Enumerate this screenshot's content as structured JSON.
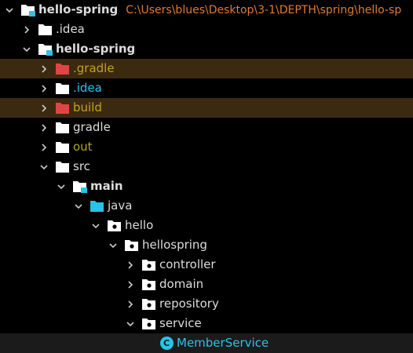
{
  "colors": {
    "background": "#000000",
    "text": "#dcdcdc",
    "excluded_text": "#c4a024",
    "output_text": "#b2a52a",
    "source_text": "#28c4e6",
    "path_text": "#e07b32",
    "excluded_row_bg": "#3c2a10",
    "selected_row_bg": "#1b1b1b",
    "folder_plain": "#ffffff",
    "folder_excluded": "#e04545",
    "folder_source": "#28c4e6",
    "module_marker": "#28c4e6"
  },
  "project": {
    "name": "hello-spring",
    "path": "C:\\Users\\blues\\Desktop\\3-1\\DEPTH\\spring\\hello-sp"
  },
  "tree": [
    {
      "label": ".idea",
      "level": 1,
      "chevron": "right",
      "icon": "folder-icon"
    },
    {
      "label": "hello-spring",
      "level": 1,
      "chevron": "down",
      "icon": "module-folder-icon",
      "bold": true
    },
    {
      "label": ".gradle",
      "level": 2,
      "chevron": "right",
      "icon": "excluded-folder-icon",
      "state": "excluded"
    },
    {
      "label": ".idea",
      "level": 2,
      "chevron": "right",
      "icon": "folder-icon",
      "state": "source"
    },
    {
      "label": "build",
      "level": 2,
      "chevron": "right",
      "icon": "excluded-folder-icon",
      "state": "excluded"
    },
    {
      "label": "gradle",
      "level": 2,
      "chevron": "right",
      "icon": "folder-icon"
    },
    {
      "label": "out",
      "level": 2,
      "chevron": "right",
      "icon": "folder-icon",
      "state": "output"
    },
    {
      "label": "src",
      "level": 2,
      "chevron": "down",
      "icon": "folder-icon"
    },
    {
      "label": "main",
      "level": 3,
      "chevron": "down",
      "icon": "module-folder-icon",
      "bold": true
    },
    {
      "label": "java",
      "level": 4,
      "chevron": "down",
      "icon": "source-folder-icon"
    },
    {
      "label": "hello",
      "level": 5,
      "chevron": "down",
      "icon": "package-icon"
    },
    {
      "label": "hellospring",
      "level": 6,
      "chevron": "down",
      "icon": "package-icon"
    },
    {
      "label": "controller",
      "level": 7,
      "chevron": "right",
      "icon": "package-icon"
    },
    {
      "label": "domain",
      "level": 7,
      "chevron": "right",
      "icon": "package-icon"
    },
    {
      "label": "repository",
      "level": 7,
      "chevron": "right",
      "icon": "package-icon"
    },
    {
      "label": "service",
      "level": 7,
      "chevron": "down",
      "icon": "package-icon"
    },
    {
      "label": "MemberService",
      "level": 8,
      "chevron": "none",
      "icon": "class-icon",
      "state": "selected"
    }
  ]
}
